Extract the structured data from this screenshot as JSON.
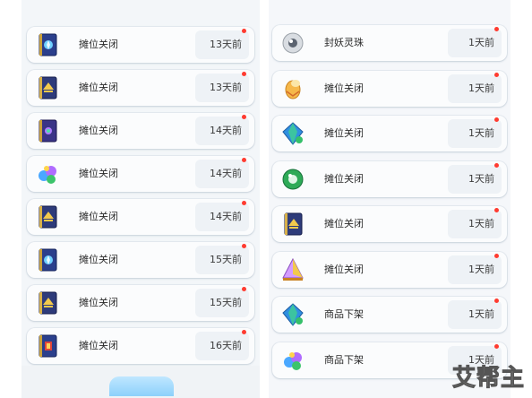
{
  "left_list": [
    {
      "icon": "blue-book-icon",
      "label": "摊位关闭",
      "time": "13天前"
    },
    {
      "icon": "gold-book-icon",
      "label": "摊位关闭",
      "time": "13天前"
    },
    {
      "icon": "purple-book-icon",
      "label": "摊位关闭",
      "time": "14天前"
    },
    {
      "icon": "colorful-gem-icon",
      "label": "摊位关闭",
      "time": "14天前"
    },
    {
      "icon": "gold-book-icon",
      "label": "摊位关闭",
      "time": "14天前"
    },
    {
      "icon": "blue-book-icon",
      "label": "摊位关闭",
      "time": "15天前"
    },
    {
      "icon": "gold-book-icon",
      "label": "摊位关闭",
      "time": "15天前"
    },
    {
      "icon": "red-book-icon",
      "label": "摊位关闭",
      "time": "16天前"
    }
  ],
  "right_list": [
    {
      "icon": "silver-orb-icon",
      "label": "封妖灵珠",
      "time": "1天前"
    },
    {
      "icon": "golden-egg-icon",
      "label": "摊位关闭",
      "time": "1天前"
    },
    {
      "icon": "blue-green-gem-icon",
      "label": "摊位关闭",
      "time": "1天前"
    },
    {
      "icon": "green-orb-icon",
      "label": "摊位关闭",
      "time": "1天前"
    },
    {
      "icon": "gold-book-icon",
      "label": "摊位关闭",
      "time": "1天前"
    },
    {
      "icon": "pyramid-crystal-icon",
      "label": "摊位关闭",
      "time": "1天前"
    },
    {
      "icon": "blue-green-gem-icon",
      "label": "商品下架",
      "time": "1天前"
    },
    {
      "icon": "colorful-gem-icon",
      "label": "商品下架",
      "time": "1天前"
    }
  ],
  "watermark": "艾帮主",
  "colors": {
    "unread_dot": "#ff3b30",
    "row_bg": "#fbfcfd",
    "time_bg": "#eef2f6",
    "bottom_button": "#8dd1fb"
  }
}
